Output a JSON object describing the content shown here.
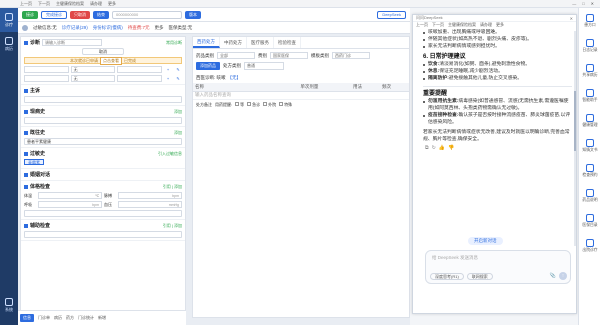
{
  "titlebar": {
    "items": [
      "上一页",
      "下一页",
      "主健康保险档案",
      "请办理",
      "更多"
    ]
  },
  "leftnav": {
    "items": [
      {
        "label": "诊疗"
      },
      {
        "label": "病历"
      },
      {
        "label": "系统"
      }
    ]
  },
  "toolbar": {
    "btn_reception": "接诊",
    "btn_complete": "完成接诊",
    "btn_cancel": "只取消",
    "btn_prescribe": "结束",
    "phone_placeholder": "0000000000",
    "mode_label": "版本",
    "deepseek_label": "DeepSeek"
  },
  "tabs2": {
    "items": [
      "过敏信息:无",
      "诊疗记录(29)",
      "身份标识(慢病)",
      "待查费:7元",
      "更多",
      "医保类型:无"
    ]
  },
  "leftpanel": {
    "diag_label": "诊断",
    "diag_placeholder": "请输入诊断",
    "diag_right": "常用诊断",
    "pill_btn": "取消",
    "warn_text": "本次就诊已申请",
    "warn_link": "点击查看",
    "warn_suffix": "已完成",
    "r1": [
      "无",
      "无"
    ],
    "sec_main": "主诉",
    "sec_present": "现病史",
    "sec_present_r": "添加",
    "sec_past": "既往史",
    "sec_past_r": "添加",
    "past_value": "患者平素健康",
    "sec_allergy": "过敏史",
    "sec_allergy_r": "引入过敏信息",
    "allergy_tag": "青霉素",
    "sec_history": "婚姻对话",
    "sec_exam": "体格检查",
    "sec_exam_r": "引用 | 添加",
    "vitals": [
      {
        "label": "体温",
        "unit": "℃"
      },
      {
        "label": "脉搏",
        "unit": "bpm"
      },
      {
        "label": "呼吸",
        "unit": "bpm"
      },
      {
        "label": "血压",
        "unit": "mmHg"
      }
    ],
    "sec_aux": "辅助检查",
    "sec_aux_r": "引用 | 添加"
  },
  "bottomtabs": [
    "信息",
    "门诊单",
    "病历",
    "药方",
    "门诊统计",
    "新增"
  ],
  "midpanel": {
    "tabs": [
      "西药处方",
      "中药处方",
      "医疗服务",
      "检验检查"
    ],
    "type_label": "药品类别",
    "type_value": "全部",
    "fee_label": "费别",
    "fee_value": "国家医保",
    "temp_label": "模板类别",
    "temp_value": "西药门诊",
    "add_btn": "添加药品",
    "use_label": "处方类别",
    "use_value": "普通",
    "diag_prefix": "西医诊断: 咳嗽",
    "diag_value": "【无】",
    "cols": [
      "名称",
      "",
      "单次剂量",
      "用法",
      "频次"
    ],
    "row_placeholder": "输入药品名称查询",
    "note_label": "处方备注",
    "note_opts": [
      "等",
      "急诊",
      "外院",
      "特殊"
    ],
    "note_inp_label": "用药提醒:"
  },
  "deepseek": {
    "title": "问问DeepSeek",
    "menu": [
      "上一页",
      "下一页",
      "主健康保险档案",
      "请办理",
      "更多"
    ],
    "lines": [
      "咳嗽加重、出现胸痛或呼吸困难。",
      "伴随其他症状(如高热不退、剧烈头痛、皮疹等)。",
      "家长无法判断病情或感到担忧时。"
    ],
    "h6": "6. 日常护理建议",
    "care": [
      {
        "b": "饮食:",
        "t": "清淡易消化(如粥、面条),避免刺激性食物。"
      },
      {
        "b": "休息:",
        "t": "保证充足睡眠,减少剧烈活动。"
      },
      {
        "b": "隔离防护:",
        "t": "避免接触其他儿童,防止交叉感染。"
      }
    ],
    "h_key": "重要提醒",
    "key": [
      {
        "b": "勿滥用抗生素:",
        "t": "病毒感染(如普通感冒、流感)无需抗生素,需遵医嘱使用(如阿莫西林、头孢类药物需确认无过敏)。"
      },
      {
        "b": "疫苗接种检查:",
        "t": "确认孩子是否按时接种流感疫苗、肺炎球菌疫苗,以评估感染风险。"
      }
    ],
    "tail": "若家长无法判断病情或症状无改善,建议及时就医以明确诊断,完善血常规、胸片等检查,确保安全。",
    "new_chat": "开启新对话",
    "input_placeholder": "给 DeepSeek 发送消息",
    "chip1": "深度思考(R1)",
    "chip2": "联网搜索"
  },
  "rightbar": [
    "患方口",
    "日志记录",
    "共享病历",
    "智能助手",
    "健康管理",
    "知情文书",
    "检查预约",
    "药品说明",
    "医保目录",
    "出院诊疗"
  ]
}
